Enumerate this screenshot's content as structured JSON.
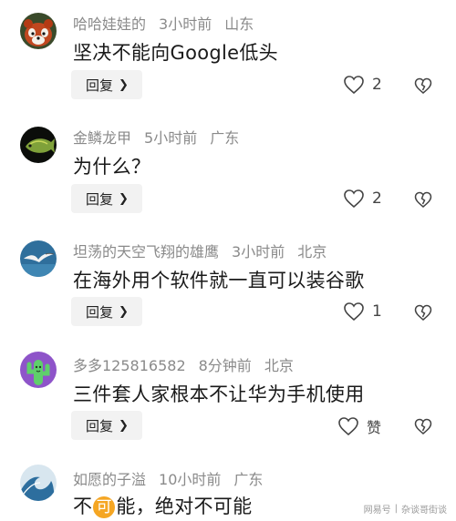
{
  "comments": [
    {
      "username": "哈哈娃娃的",
      "time": "3小时前",
      "location": "山东",
      "content": "坚决不能向Google低头",
      "likes": "2",
      "avatar_icon": "red-panda-avatar"
    },
    {
      "username": "金鳞龙甲",
      "time": "5小时前",
      "location": "广东",
      "content": "为什么？",
      "likes": "2",
      "avatar_icon": "arowana-fish-avatar"
    },
    {
      "username": "坦荡的天空飞翔的雄鹰",
      "time": "3小时前",
      "location": "北京",
      "content": "在海外用个软件就一直可以装谷歌",
      "likes": "1",
      "avatar_icon": "seagull-avatar"
    },
    {
      "username": "多多125816582",
      "time": "8分钟前",
      "location": "北京",
      "content": "三件套人家根本不让华为手机使用",
      "likes": "赞",
      "avatar_icon": "cactus-avatar"
    },
    {
      "username": "如愿的子溢",
      "time": "10小时前",
      "location": "广东",
      "content_before": "不",
      "content_highlight": "可",
      "content_after": "能，绝对不可能",
      "avatar_icon": "wave-avatar"
    }
  ],
  "reply_label": "回复",
  "watermark": {
    "left": "网易号",
    "right": "杂谈哥街谈"
  },
  "colors": {
    "meta_gray": "#8a8a8a",
    "reply_bg": "#f2f2f2",
    "highlight": "#f5a623"
  }
}
